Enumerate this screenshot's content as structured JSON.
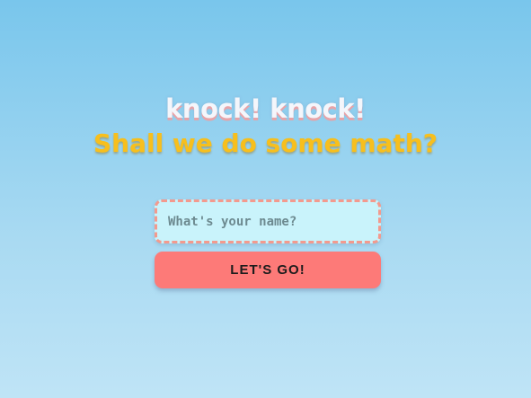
{
  "greeting": "knock! knock!",
  "headline": "Shall we do some math?",
  "form": {
    "name_placeholder": "What's your name?",
    "name_value": "",
    "submit_label": "LET'S GO!"
  },
  "colors": {
    "background_top": "#79c6ec",
    "background_bottom": "#bfe4f6",
    "greeting_text": "#f4f6fb",
    "greeting_shadow": "#e7a3a8",
    "headline_text": "#f7bf1d",
    "input_background": "#c9f3fb",
    "input_border": "#f39a8e",
    "button_background": "#fd7a78",
    "button_text": "#1c1c1c"
  }
}
